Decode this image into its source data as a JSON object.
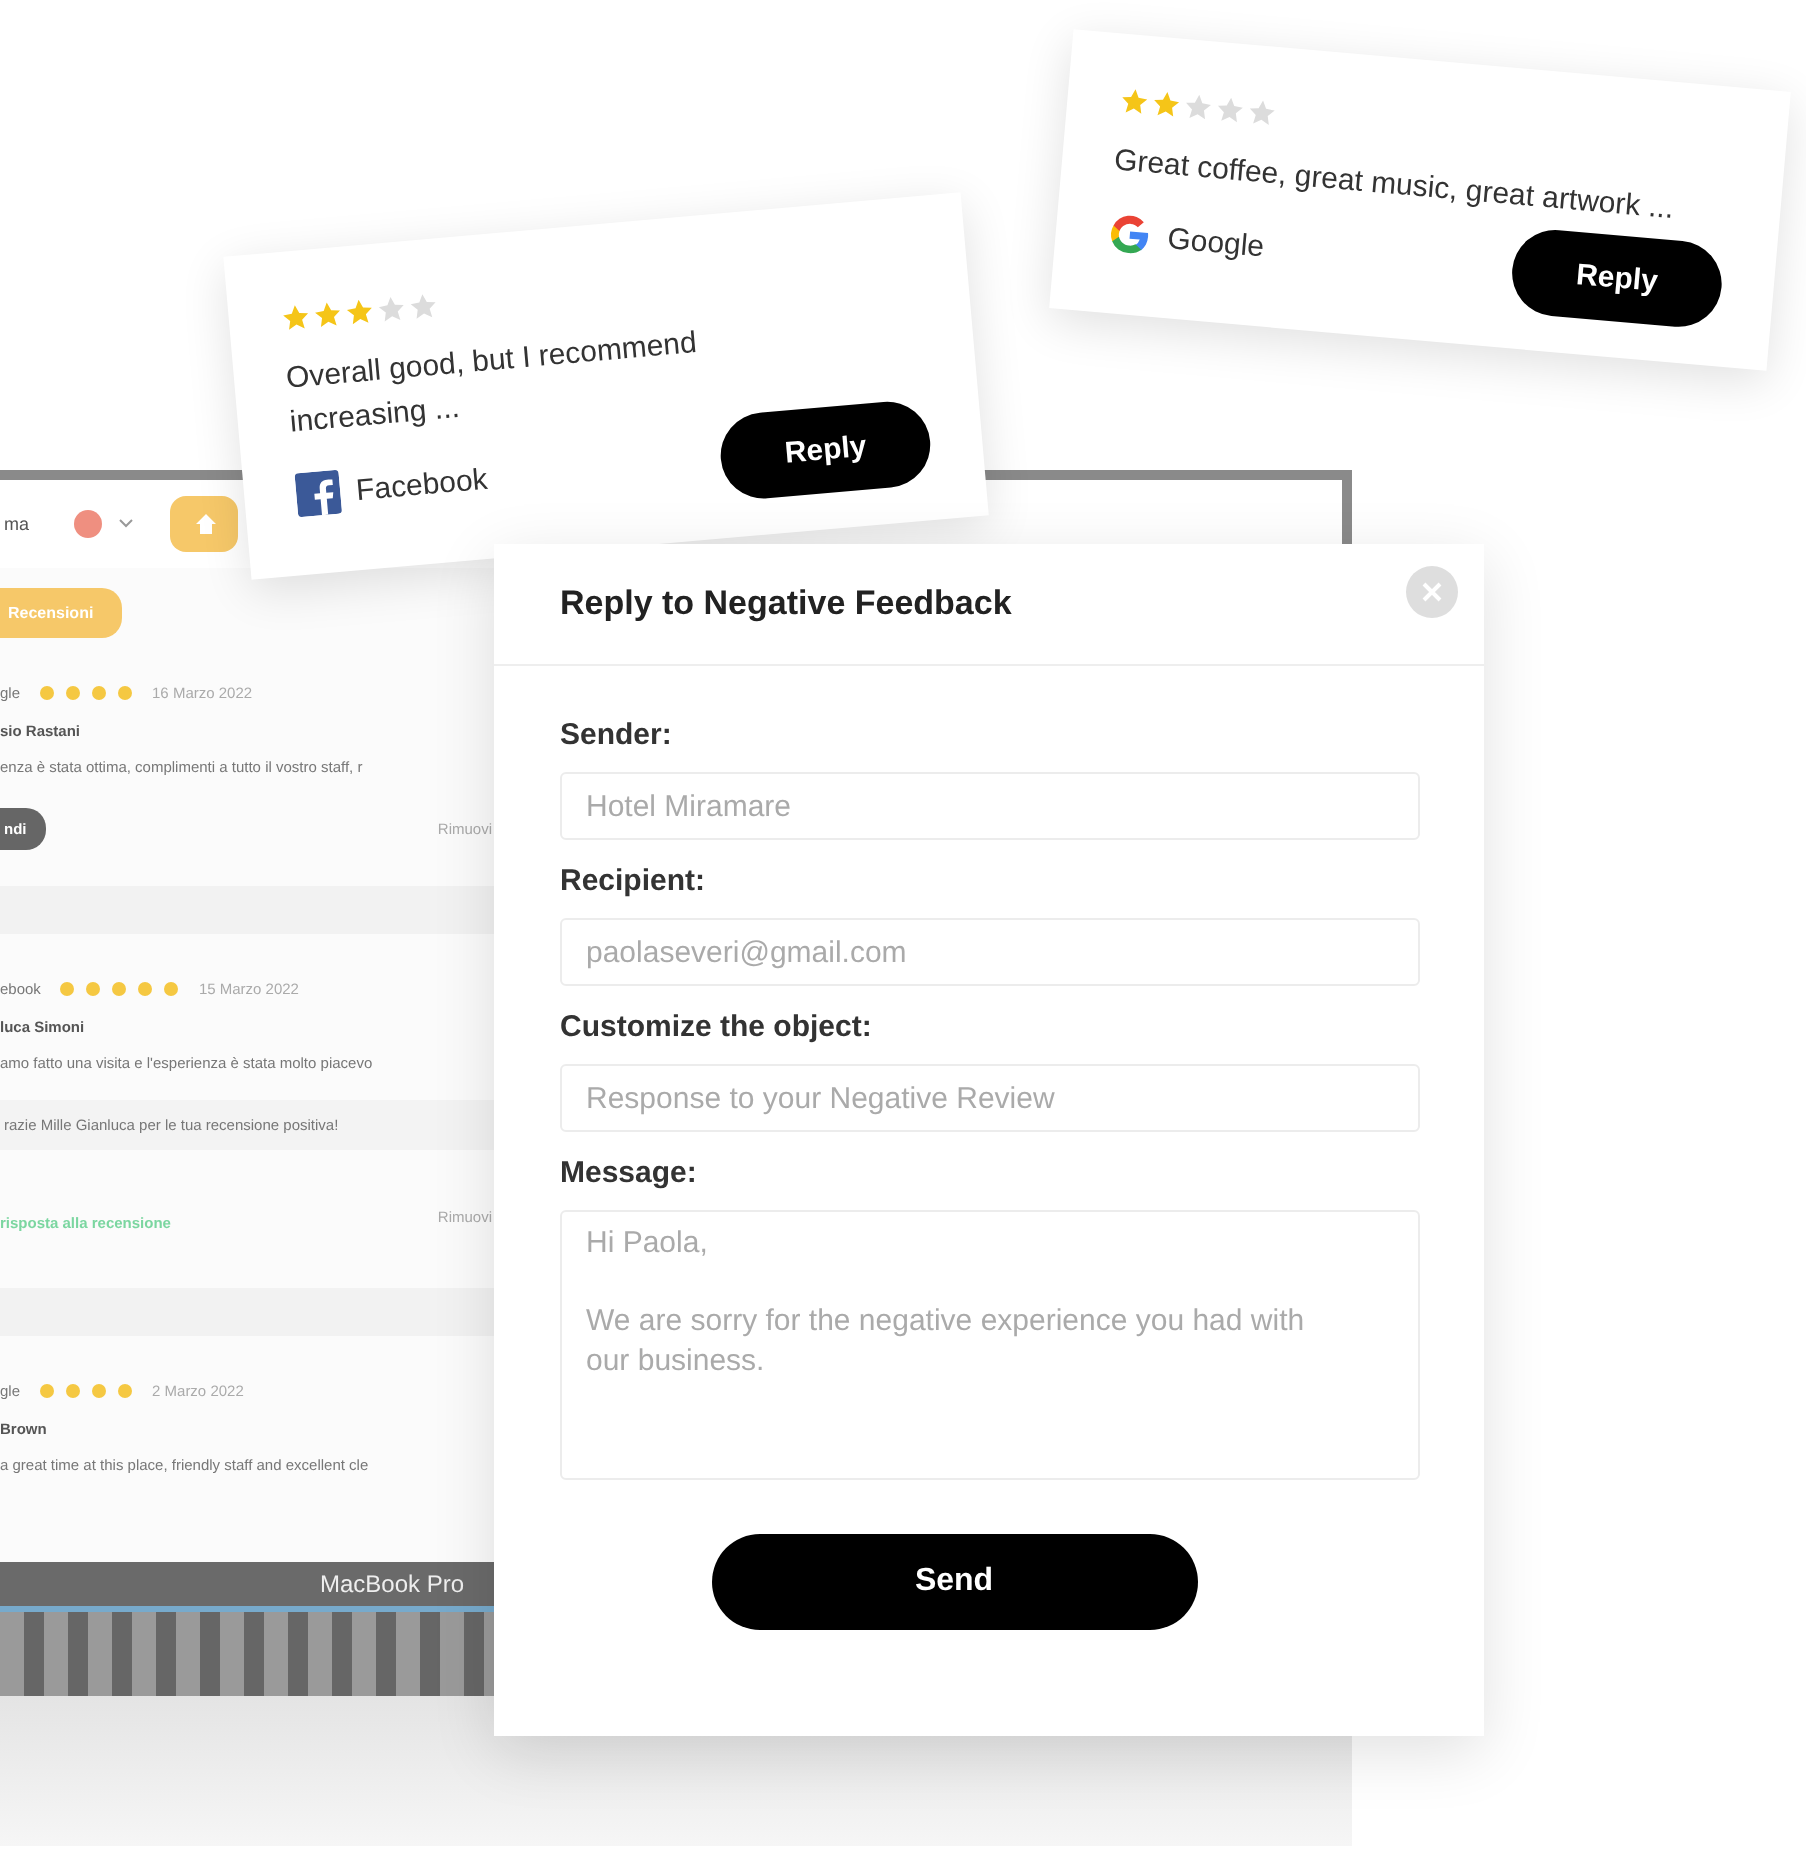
{
  "app_screen": {
    "topbar": {
      "label": "ma"
    },
    "tab": {
      "label": "Recensioni"
    },
    "reviews": [
      {
        "source": "gle",
        "stars": 4,
        "date": "16 Marzo 2022",
        "name": "sio Rastani",
        "text": "enza è stata ottima, complimenti a tutto il vostro staff, r",
        "action": {
          "kind": "button",
          "label": "ndi"
        },
        "remove": "Rimuovi"
      },
      {
        "source": "ebook",
        "stars": 5,
        "date": "15 Marzo 2022",
        "name": "luca Simoni",
        "text": "amo fatto una visita e l'esperienza è stata molto piacevo",
        "reply": "razie Mille Gianluca per le tua recensione positiva!",
        "action": {
          "kind": "link",
          "label": "risposta alla recensione"
        },
        "remove": "Rimuovi"
      },
      {
        "source": "gle",
        "stars": 4,
        "date": "2 Marzo 2022",
        "name": "Brown",
        "text": "a great time at this place, friendly staff and excellent cle"
      }
    ]
  },
  "laptop": {
    "model": "MacBook Pro"
  },
  "review_cards": [
    {
      "stars": 3,
      "text": "Overall good, but I recommend increasing ...",
      "platform": {
        "kind": "facebook",
        "name": "Facebook"
      },
      "button": "Reply"
    },
    {
      "stars": 2,
      "text": "Great coffee, great music, great artwork ...",
      "platform": {
        "kind": "google",
        "name": "Google"
      },
      "button": "Reply"
    }
  ],
  "dialog": {
    "title": "Reply to Negative Feedback",
    "fields": [
      {
        "kind": "input",
        "label": "Sender:",
        "value": "Hotel Miramare"
      },
      {
        "kind": "input",
        "label": "Recipient:",
        "value": "paolaseveri@gmail.com"
      },
      {
        "kind": "input",
        "label": "Customize the object:",
        "value": "Response to your Negative Review"
      },
      {
        "kind": "textarea",
        "label": "Message:",
        "value": "Hi Paola,\n\nWe are sorry for the negative experience you had with our business."
      }
    ],
    "button": "Send"
  }
}
